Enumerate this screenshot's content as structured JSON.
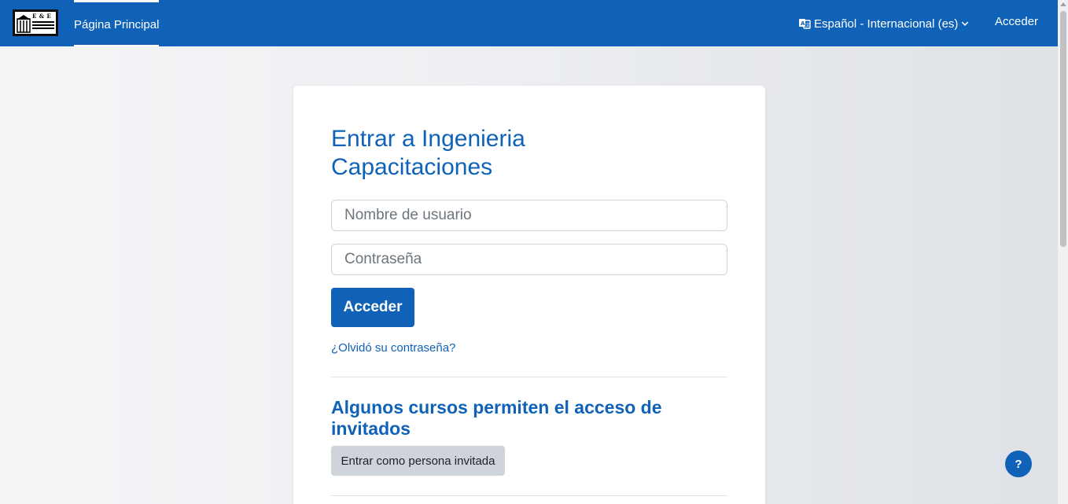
{
  "navbar": {
    "logo_text": "E & E",
    "home_label": "Página Principal",
    "language_label": "Español - Internacional (es)",
    "login_label": "Acceder"
  },
  "login": {
    "title": "Entrar a Ingenieria Capacitaciones",
    "username_placeholder": "Nombre de usuario",
    "password_placeholder": "Contraseña",
    "submit_label": "Acceder",
    "forgot_label": "¿Olvidó su contraseña?"
  },
  "guest": {
    "title": "Algunos cursos permiten el acceso de invitados",
    "button_label": "Entrar como persona invitada"
  },
  "help": {
    "label": "?"
  },
  "colors": {
    "brand": "#0f62b7",
    "secondary_button": "#ced4da"
  }
}
